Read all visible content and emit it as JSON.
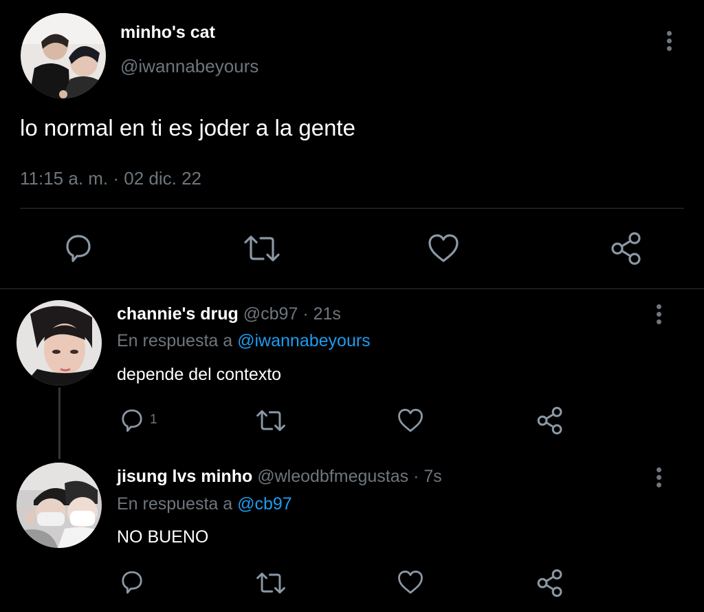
{
  "main_tweet": {
    "display_name": "minho's cat",
    "handle": "@iwannabeyours",
    "text": "lo normal en ti es joder a la gente",
    "timestamp": "11:15 a. m. · 02 dic. 22",
    "actions": [
      "reply-icon",
      "retweet-icon",
      "like-icon",
      "share-icon"
    ]
  },
  "replies": [
    {
      "display_name": "channie's drug",
      "handle": "@cb97",
      "time": "· 21s",
      "in_reply_prefix": "En respuesta a",
      "in_reply_to": "@iwannabeyours",
      "text": "depende del contexto",
      "reply_count": "1"
    },
    {
      "display_name": "jisung lvs minho",
      "handle": "@wleodbfmegustas",
      "time": "· 7s",
      "in_reply_prefix": "En respuesta a",
      "in_reply_to": "@cb97",
      "text": "NO BUENO",
      "reply_count": ""
    }
  ],
  "colors": {
    "background": "#000000",
    "muted": "#6e767d",
    "link": "#1d9bf0",
    "divider": "#2f3336"
  }
}
